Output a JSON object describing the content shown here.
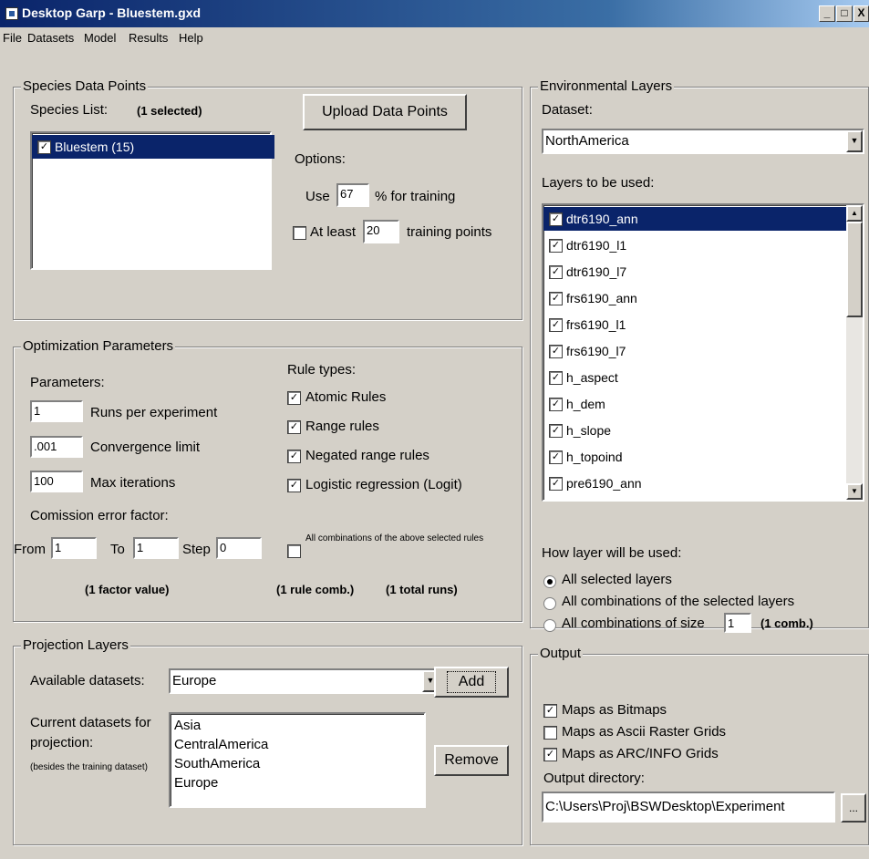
{
  "window": {
    "title": "Desktop Garp - Bluestem.gxd",
    "controls": [
      "_",
      "□",
      "X"
    ]
  },
  "menu": [
    "File",
    "Datasets",
    "Model",
    "Results",
    "Help"
  ],
  "species": {
    "group_label": "Species Data Points",
    "list_label": "Species List:",
    "selected_count": "(1 selected)",
    "items": [
      {
        "label": "Bluestem (15)",
        "checked": true,
        "selected": true
      }
    ],
    "upload_button": "Upload Data Points",
    "options_label": "Options:",
    "use_label": "Use",
    "use_value": "67",
    "training_pct_label": "% for training",
    "atleast_checked": false,
    "atleast_label": "At least",
    "atleast_value": "20",
    "training_points_label": "training points"
  },
  "optimization": {
    "group_label": "Optimization Parameters",
    "parameters_label": "Parameters:",
    "runs_value": "1",
    "runs_label": "Runs per experiment",
    "convergence_value": ".001",
    "convergence_label": "Convergence limit",
    "maxiter_value": "100",
    "maxiter_label": "Max iterations",
    "comission_label": "Comission error factor:",
    "from_label": "From",
    "from_value": "1",
    "to_label": "To",
    "to_value": "1",
    "step_label": "Step",
    "step_value": "0",
    "factor_summary": "(1 factor value)",
    "rule_types_label": "Rule types:",
    "rules": [
      {
        "label": "Atomic Rules",
        "checked": true
      },
      {
        "label": "Range rules",
        "checked": true
      },
      {
        "label": "Negated range rules",
        "checked": true
      },
      {
        "label": "Logistic regression (Logit)",
        "checked": true
      }
    ],
    "all_combinations_label": "All combinations of the above selected rules",
    "all_combinations_checked": false,
    "rule_comb_summary": "(1 rule comb.)",
    "total_runs_summary": "(1 total runs)"
  },
  "projection": {
    "group_label": "Projection Layers",
    "available_label": "Available datasets:",
    "available_value": "Europe",
    "add_button": "Add",
    "current_label": "Current datasets for projection:",
    "current_note": "(besides the training dataset)",
    "current_items": [
      "Asia",
      "CentralAmerica",
      "SouthAmerica",
      "Europe"
    ],
    "remove_button": "Remove"
  },
  "environment": {
    "group_label": "Environmental Layers",
    "dataset_label": "Dataset:",
    "dataset_value": "NorthAmerica",
    "layers_label": "Layers to be used:",
    "layers": [
      {
        "label": "dtr6190_ann",
        "checked": true,
        "selected": true
      },
      {
        "label": "dtr6190_l1",
        "checked": true,
        "selected": false
      },
      {
        "label": "dtr6190_l7",
        "checked": true,
        "selected": false
      },
      {
        "label": "frs6190_ann",
        "checked": true,
        "selected": false
      },
      {
        "label": "frs6190_l1",
        "checked": true,
        "selected": false
      },
      {
        "label": "frs6190_l7",
        "checked": true,
        "selected": false
      },
      {
        "label": "h_aspect",
        "checked": true,
        "selected": false
      },
      {
        "label": "h_dem",
        "checked": true,
        "selected": false
      },
      {
        "label": "h_slope",
        "checked": true,
        "selected": false
      },
      {
        "label": "h_topoind",
        "checked": true,
        "selected": false
      },
      {
        "label": "pre6190_ann",
        "checked": true,
        "selected": false
      }
    ],
    "usage_label": "How layer will be used:",
    "usage_options": [
      {
        "label": "All selected layers",
        "selected": true
      },
      {
        "label": "All combinations of the selected layers",
        "selected": false
      },
      {
        "label": "All combinations of size",
        "selected": false
      }
    ],
    "size_value": "1",
    "comb_summary": "(1 comb.)"
  },
  "output": {
    "group_label": "Output",
    "options": [
      {
        "label": "Maps as Bitmaps",
        "checked": true
      },
      {
        "label": "Maps as Ascii Raster Grids",
        "checked": false
      },
      {
        "label": "Maps as ARC/INFO Grids",
        "checked": true
      }
    ],
    "directory_label": "Output directory:",
    "directory_value": "C:\\Users\\Proj\\BSWDesktop\\Experiment",
    "browse_button": "..."
  }
}
